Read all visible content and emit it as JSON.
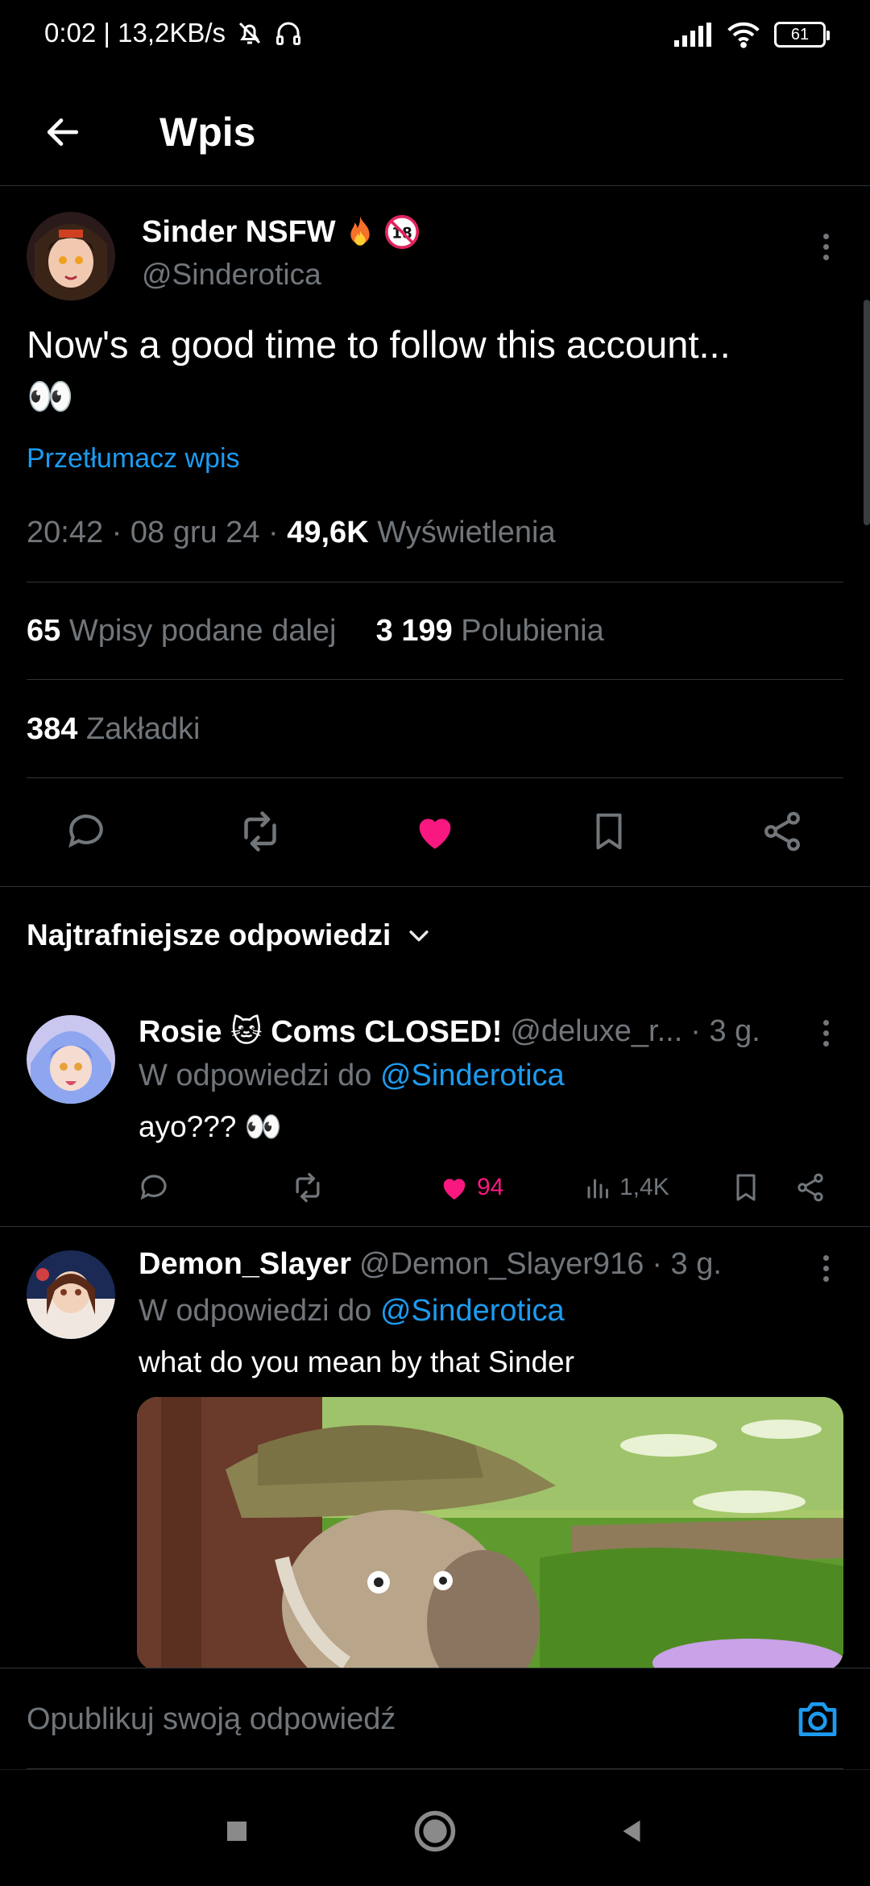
{
  "status_bar": {
    "time_speed": "0:02 | 13,2KB/s",
    "battery": "61"
  },
  "header": {
    "title": "Wpis"
  },
  "post": {
    "author_name": "Sinder NSFW",
    "author_handle": "@Sinderotica",
    "text": "Now's a good time to follow this account...",
    "emoji": "👀",
    "translate_link": "Przetłumacz wpis",
    "time": "20:42",
    "date": "08 gru 24",
    "views_count": "49,6K",
    "views_label": "Wyświetlenia",
    "reposts_count": "65",
    "reposts_label": "Wpisy podane dalej",
    "likes_count": "3 199",
    "likes_label": "Polubienia",
    "bookmarks_count": "384",
    "bookmarks_label": "Zakładki",
    "liked": true
  },
  "replies_header": {
    "label": "Najtrafniejsze odpowiedzi"
  },
  "replies": [
    {
      "name": "Rosie 🐱 Coms CLOSED!",
      "handle": "@deluxe_r...",
      "time": "· 3 g.",
      "reply_to_label": "W odpowiedzi do",
      "reply_to_handle": "@Sinderotica",
      "text": "ayo??? 👀",
      "likes": "94",
      "views": "1,4K"
    },
    {
      "name": "Demon_Slayer",
      "handle": "@Demon_Slayer916",
      "time": "· 3 g.",
      "reply_to_label": "W odpowiedzi do",
      "reply_to_handle": "@Sinderotica",
      "text": "what do you mean by that Sinder"
    }
  ],
  "compose": {
    "placeholder": "Opublikuj swoją odpowiedź"
  },
  "colors": {
    "accent": "#1d9bf0",
    "like": "#f91880",
    "muted": "#71767b",
    "background": "#000000"
  }
}
